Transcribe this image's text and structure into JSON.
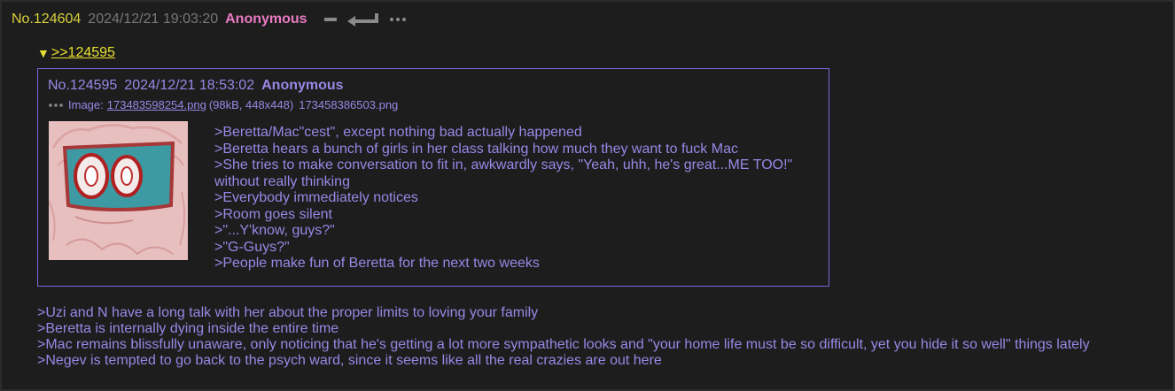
{
  "post": {
    "number": "No.124604",
    "date": "2024/12/21 19:03:20",
    "name": "Anonymous",
    "icons": [
      "minus-icon",
      "reply-arrow-icon",
      "more-icon"
    ],
    "body_lines": [
      ">Uzi and N have a long talk with her about the proper limits to loving your family",
      ">Beretta is internally dying inside the entire time",
      ">Mac remains blissfully unaware, only noticing that he's getting a lot more sympathetic looks and \"your home life must be so difficult, yet you hide it so well\" things lately",
      ">Negev is tempted to go back to the psych ward, since it seems like all the real crazies are out here"
    ]
  },
  "quote_link": {
    "arrow": "▼",
    "text": ">>124595"
  },
  "quoted_post": {
    "number": "No.124595",
    "date": "2024/12/21 18:53:02",
    "name": "Anonymous",
    "file": {
      "label": "Image:",
      "filename": "173483598254.png",
      "meta": "(98kB, 448x448)",
      "original_name": "173458386503.png"
    },
    "body_lines": [
      ">Beretta/Mac\"cest\", except nothing bad actually happened",
      ">Beretta hears a bunch of girls in her class talking how much they want to fuck Mac",
      ">She tries to make conversation to fit in, awkwardly says, \"Yeah, uhh, he's great...ME TOO!\" without really thinking",
      ">Everybody immediately notices",
      ">Room goes silent",
      ">\"...Y'know, guys?\"",
      ">\"G-Guys?\"",
      ">People make fun of Beretta for the next two weeks"
    ]
  },
  "colors": {
    "background": "#1d1d1d",
    "post_number": "#d8cf3a",
    "date": "#777777",
    "name": "#e87ac2",
    "quote_text": "#9a87e6",
    "quote_border": "#7a66d8",
    "link_yellow": "#e8e030"
  }
}
